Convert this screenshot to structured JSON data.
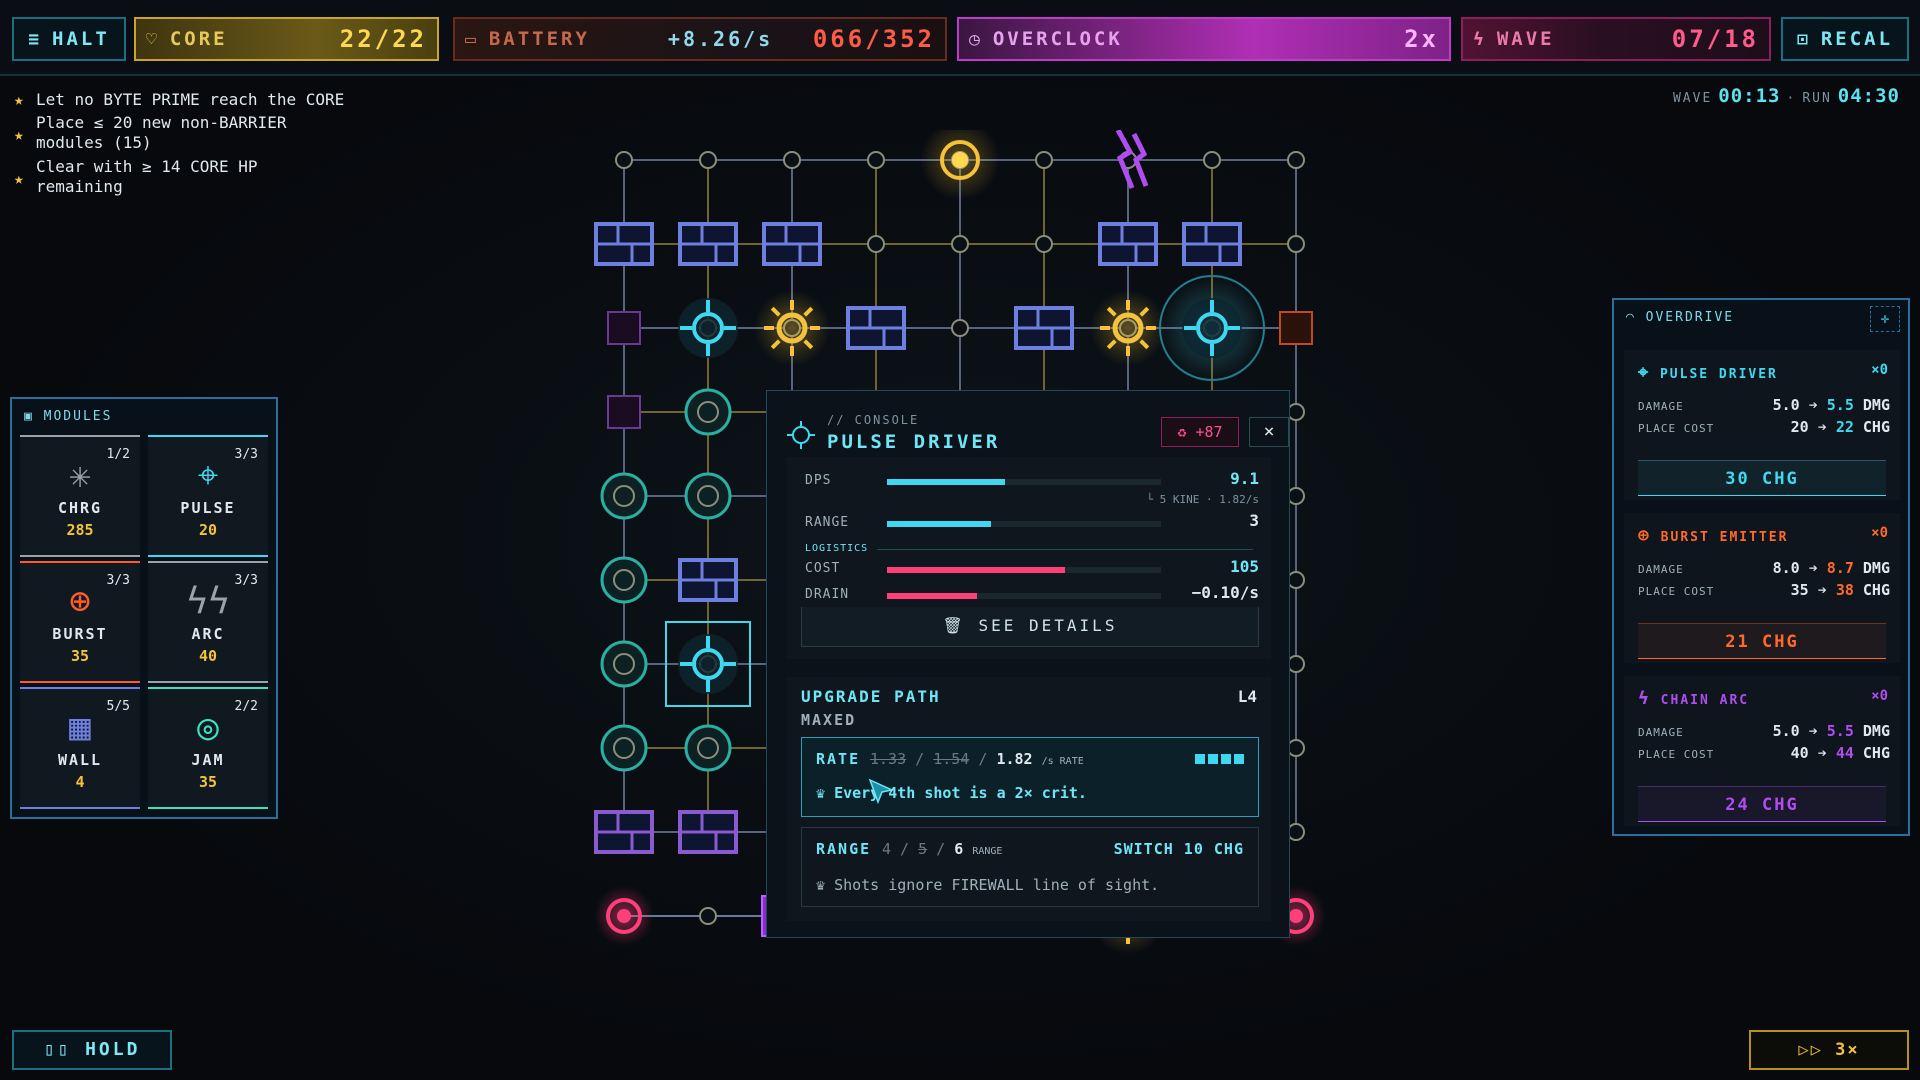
{
  "topbar": {
    "halt": "HALT",
    "core_label": "CORE",
    "core_value": "22/22",
    "battery_label": "BATTERY",
    "battery_rate": "+8.26/s",
    "battery_value": "066/352",
    "overclock_label": "OVERCLOCK",
    "overclock_value": "2x",
    "wave_label": "WAVE",
    "wave_value": "07/18",
    "recal": "RECAL"
  },
  "objectives": [
    "Let no BYTE PRIME reach the CORE",
    "Place ≤ 20 new non-BARRIER modules (15)",
    "Clear with ≥ 14 CORE HP remaining"
  ],
  "timer": {
    "wave_label": "WAVE",
    "wave_time": "00:13",
    "sep": "·",
    "run_label": "RUN",
    "run_time": "04:30"
  },
  "modules": {
    "title": "MODULES",
    "items": [
      {
        "name": "CHRG",
        "cost": "285",
        "count": "1/2",
        "icon": "charger-icon",
        "color": "#9aa3ad"
      },
      {
        "name": "PULSE",
        "cost": "20",
        "count": "3/3",
        "icon": "pulse-icon",
        "color": "#3fd8f0"
      },
      {
        "name": "BURST",
        "cost": "35",
        "count": "3/3",
        "icon": "burst-icon",
        "color": "#ff5a2a"
      },
      {
        "name": "ARC",
        "cost": "40",
        "count": "3/3",
        "icon": "arc-icon",
        "color": "#9aa3ad"
      },
      {
        "name": "WALL",
        "cost": "4",
        "count": "5/5",
        "icon": "wall-icon",
        "color": "#6f7fe0"
      },
      {
        "name": "JAM",
        "cost": "35",
        "count": "2/2",
        "icon": "jam-icon",
        "color": "#3fe0c0"
      }
    ]
  },
  "console": {
    "sub": "// CONSOLE",
    "title": "PULSE DRIVER",
    "badge": "+87",
    "close": "×",
    "dps_label": "DPS",
    "dps_value": "9.1",
    "dps_fill": 0.43,
    "dps_note": "└ 5 KINE · 1.82/s",
    "range_label": "RANGE",
    "range_value": "3",
    "range_fill": 0.38,
    "logistics": "LOGISTICS",
    "cost_label": "COST",
    "cost_value": "105",
    "cost_fill": 0.65,
    "drain_label": "DRAIN",
    "drain_value": "−0.10/s",
    "drain_fill": 0.33,
    "details": "SEE DETAILS",
    "upgrade_title": "UPGRADE PATH",
    "upgrade_level": "L4",
    "upgrade_state": "MAXED",
    "rate_label": "RATE",
    "rate_old1": "1.33",
    "rate_old2": "1.54",
    "rate_new": "1.82",
    "rate_unit": "/s RATE",
    "rate_perk": "Every 4th shot is a 2× crit.",
    "range2_label": "RANGE",
    "range_old1": "4",
    "range_old2": "5",
    "range_new": "6",
    "range_unit": "RANGE",
    "switch": "SWITCH 10 CHG",
    "range_perk": "Shots ignore FIREWALL line of sight."
  },
  "overdrive": {
    "title": "OVERDRIVE",
    "cards": [
      {
        "name": "PULSE DRIVER",
        "mult": "×0",
        "color": "#3fd8f0",
        "dmg_label": "DAMAGE",
        "dmg_old": "5.0",
        "dmg_new": "5.5",
        "dmg_unit": "DMG",
        "cost_label": "PLACE COST",
        "cost_old": "20",
        "cost_new": "22",
        "cost_unit": "CHG",
        "button": "30 CHG"
      },
      {
        "name": "BURST EMITTER",
        "mult": "×0",
        "color": "#ff6a2a",
        "dmg_label": "DAMAGE",
        "dmg_old": "8.0",
        "dmg_new": "8.7",
        "dmg_unit": "DMG",
        "cost_label": "PLACE COST",
        "cost_old": "35",
        "cost_new": "38",
        "cost_unit": "CHG",
        "button": "21 CHG"
      },
      {
        "name": "CHAIN ARC",
        "mult": "×0",
        "color": "#b04cf0",
        "dmg_label": "DAMAGE",
        "dmg_old": "5.0",
        "dmg_new": "5.5",
        "dmg_unit": "DMG",
        "cost_label": "PLACE COST",
        "cost_old": "40",
        "cost_new": "44",
        "cost_unit": "CHG",
        "button": "24 CHG"
      }
    ]
  },
  "bottom": {
    "hold": "HOLD",
    "speed": "3×"
  },
  "colors": {
    "accent": "#3fd8f0",
    "gold": "#f5c23a",
    "magenta": "#ff3f7a",
    "violet": "#b04cf0",
    "wall": "#6f7fe0"
  }
}
